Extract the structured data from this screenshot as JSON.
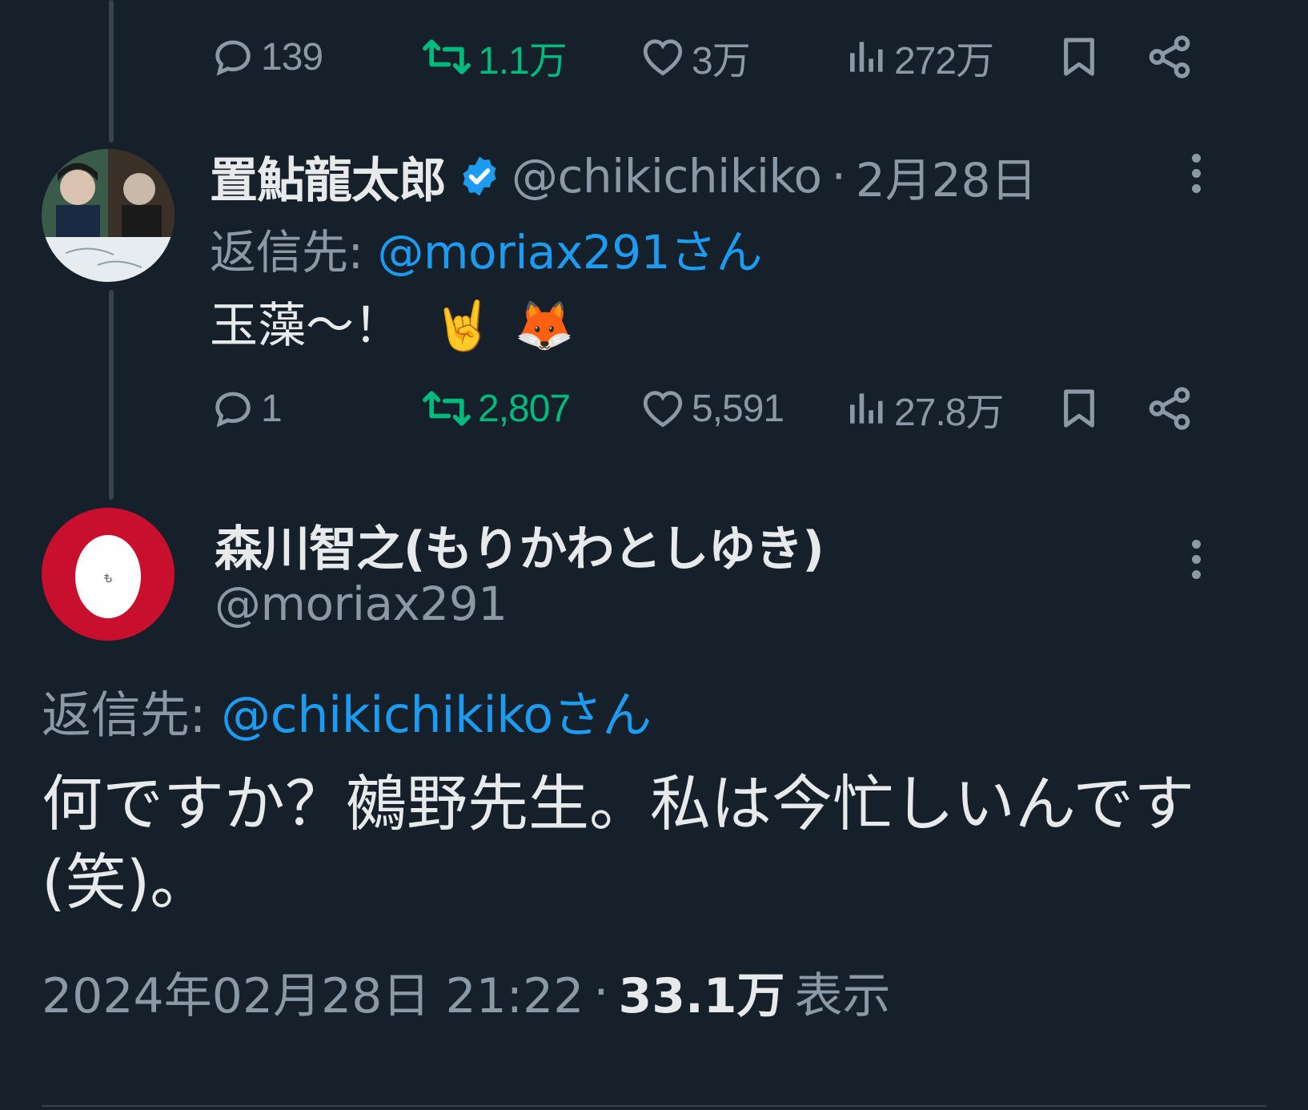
{
  "top_actions": {
    "replies": "139",
    "retweets": "1.1万",
    "likes": "3万",
    "views": "272万"
  },
  "reply_tweet": {
    "display_name": "置鮎龍太郎",
    "handle": "@chikichikiko",
    "separator": "·",
    "date": "2月28日",
    "reply_prefix": "返信先: ",
    "reply_mention": "@moriax291さん",
    "text": "玉藻〜！",
    "emoji_1": "🤘",
    "emoji_2": "🦊",
    "actions": {
      "replies": "1",
      "retweets": "2,807",
      "likes": "5,591",
      "views": "27.8万"
    }
  },
  "main_tweet": {
    "display_name": "森川智之(もりかわとしゆき)",
    "handle": "@moriax291",
    "avatar_text": "も",
    "reply_prefix": "返信先: ",
    "reply_mention": "@chikichikikoさん",
    "text_line_1": "何ですか？鵺野先生。私は今忙しいんです",
    "text_line_2": "(笑)。",
    "timestamp": "2024年02月28日 21:22",
    "separator": "·",
    "views_count": "33.1万",
    "views_label": "表示"
  },
  "icons": {
    "reply": "speech-bubble-icon",
    "retweet": "retweet-arrows-icon",
    "like": "heart-icon",
    "views": "bar-chart-icon",
    "bookmark": "bookmark-icon",
    "share": "share-icon",
    "verified": "verified-badge-icon",
    "more": "more-vertical-icon"
  },
  "colors": {
    "background": "#15202b",
    "text": "#e7e9ea",
    "muted": "#8b98a5",
    "link": "#1d9bf0",
    "retweet": "#00ba7c",
    "verified": "#1d9bf0",
    "avatar_ring": "#c8102e"
  }
}
